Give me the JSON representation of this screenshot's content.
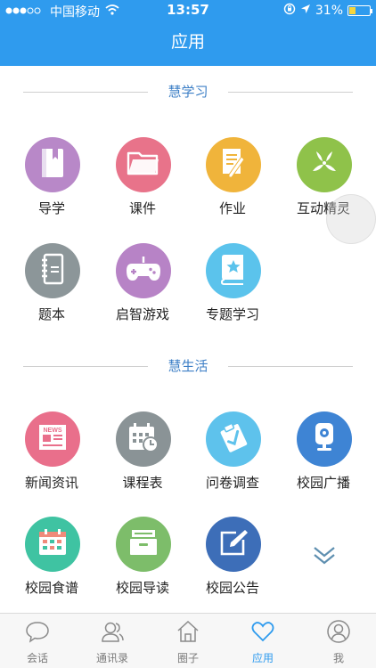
{
  "status_bar": {
    "carrier": "中国移动",
    "time": "13:57",
    "battery_text": "31%",
    "battery_level": 0.31
  },
  "nav": {
    "title": "应用"
  },
  "sections": [
    {
      "title": "慧学习",
      "apps": [
        {
          "label": "导学",
          "icon": "book-icon",
          "color": "#b888c8"
        },
        {
          "label": "课件",
          "icon": "folder-icon",
          "color": "#e8738a"
        },
        {
          "label": "作业",
          "icon": "document-pen-icon",
          "color": "#f0b43b"
        },
        {
          "label": "互动精灵",
          "icon": "sprite-icon",
          "color": "#8fc24a"
        },
        {
          "label": "题本",
          "icon": "notebook-icon",
          "color": "#8c9699"
        },
        {
          "label": "启智游戏",
          "icon": "gamepad-icon",
          "color": "#b783c6"
        },
        {
          "label": "专题学习",
          "icon": "star-book-icon",
          "color": "#5bc3ec"
        }
      ]
    },
    {
      "title": "慧生活",
      "apps": [
        {
          "label": "新闻资讯",
          "icon": "news-icon",
          "color": "#e96f8b",
          "icon_text": "NEWS"
        },
        {
          "label": "课程表",
          "icon": "calendar-clock-icon",
          "color": "#8a9396"
        },
        {
          "label": "问卷调查",
          "icon": "survey-icon",
          "color": "#5ec2ec"
        },
        {
          "label": "校园广播",
          "icon": "broadcast-camera-icon",
          "color": "#3e84d4"
        },
        {
          "label": "校园食谱",
          "icon": "menu-calendar-icon",
          "color": "#3fc3a2"
        },
        {
          "label": "校园导读",
          "icon": "archive-box-icon",
          "color": "#7dbd6a"
        },
        {
          "label": "校园公告",
          "icon": "notice-edit-icon",
          "color": "#3d6eb8"
        }
      ]
    }
  ],
  "tabs": [
    {
      "label": "会话",
      "icon": "chat-bubble-icon",
      "active": false
    },
    {
      "label": "通讯录",
      "icon": "contacts-icon",
      "active": false
    },
    {
      "label": "圈子",
      "icon": "home-icon",
      "active": false
    },
    {
      "label": "应用",
      "icon": "heart-icon",
      "active": true
    },
    {
      "label": "我",
      "icon": "user-icon",
      "active": false
    }
  ],
  "colors": {
    "primary": "#2f9bee",
    "section_title": "#3d7fc6",
    "tab_inactive": "#7a7a7a"
  }
}
